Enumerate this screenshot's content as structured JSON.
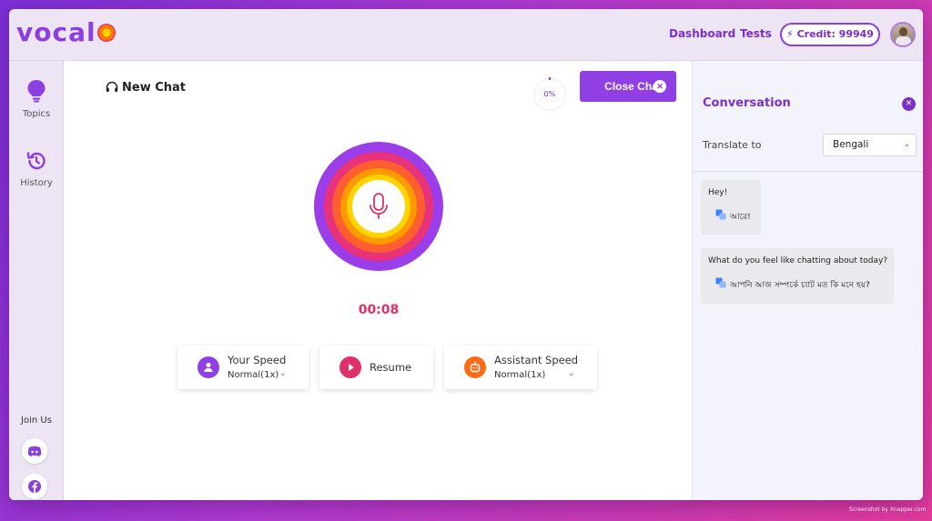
{
  "app": {
    "logo": "vocal"
  },
  "header": {
    "nav": [
      "Dashboard",
      "Tests"
    ],
    "credit_label": "⚡ Credit: 99949"
  },
  "sidebar": {
    "items": [
      {
        "label": "Topics",
        "icon": "bulb-icon"
      },
      {
        "label": "History",
        "icon": "history-icon"
      }
    ],
    "join_us": "Join Us",
    "socials": [
      "discord-icon",
      "facebook-icon"
    ]
  },
  "chat": {
    "title": "New Chat",
    "progress": "0%",
    "close_label": "Close Chat",
    "timer": "00:08"
  },
  "controls": {
    "your_speed": {
      "title": "Your Speed",
      "value": "Normal(1x)"
    },
    "resume": "Resume",
    "assistant_speed": {
      "title": "Assistant Speed",
      "value": "Normal(1x)"
    }
  },
  "conversation": {
    "title": "Conversation",
    "translate_label": "Translate to",
    "language": "Bengali",
    "messages": [
      {
        "text": "Hey!",
        "translation": "আরে!"
      },
      {
        "text": "What do you feel like chatting about today?",
        "translation": "আপনি আজ সম্পর্কে চ্যাট মত কি মনে হয়?"
      }
    ]
  },
  "colors": {
    "brand": "#8b3fe0",
    "accent_pink": "#e0306a",
    "ring_outer": "#9b3de8",
    "ring_2": "#e8327a",
    "ring_3": "#ff5f2e",
    "ring_4": "#ff9a00",
    "ring_5": "#ffd400"
  },
  "watermark": "Screenshot by Xnapper.com"
}
